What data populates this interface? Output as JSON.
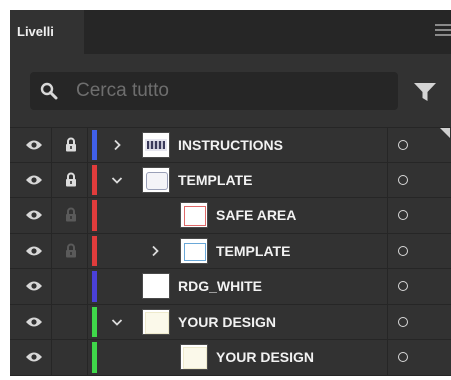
{
  "panel": {
    "tab_label": "Livelli",
    "menu_icon": "hamburger-menu-icon"
  },
  "search": {
    "placeholder": "Cerca tutto",
    "value": "",
    "icon": "search-icon",
    "filter_icon": "filter-icon"
  },
  "colors": {
    "panel_bg": "#323232",
    "tabbar_bg": "#262626",
    "text": "#f2f2f2",
    "layer_blue": "#3a4fd8",
    "layer_red": "#e03c3c",
    "layer_green": "#3fd84a"
  },
  "layers": [
    {
      "name": "INSTRUCTIONS",
      "visible": true,
      "locked": true,
      "lock_dim": false,
      "color": "#4060e8",
      "depth": 0,
      "chevron": "right",
      "thumb": "instructions"
    },
    {
      "name": "TEMPLATE",
      "visible": true,
      "locked": true,
      "lock_dim": false,
      "color": "#e03c3c",
      "depth": 0,
      "chevron": "down",
      "thumb": "template-gray"
    },
    {
      "name": "SAFE AREA",
      "visible": true,
      "locked": true,
      "lock_dim": true,
      "color": "#e03c3c",
      "depth": 1,
      "chevron": "none",
      "thumb": "safe-red"
    },
    {
      "name": "TEMPLATE",
      "visible": true,
      "locked": true,
      "lock_dim": true,
      "color": "#e03c3c",
      "depth": 1,
      "chevron": "right",
      "thumb": "template-blue"
    },
    {
      "name": "RDG_WHITE",
      "visible": true,
      "locked": false,
      "lock_dim": false,
      "color": "#4a40d8",
      "depth": 0,
      "chevron": "none",
      "thumb": "white"
    },
    {
      "name": "YOUR DESIGN",
      "visible": true,
      "locked": false,
      "lock_dim": false,
      "color": "#3fd84a",
      "depth": 0,
      "chevron": "down",
      "thumb": "design-cream"
    },
    {
      "name": "YOUR DESIGN",
      "visible": true,
      "locked": false,
      "lock_dim": false,
      "color": "#3fd84a",
      "depth": 1,
      "chevron": "none",
      "thumb": "design-cream"
    }
  ]
}
